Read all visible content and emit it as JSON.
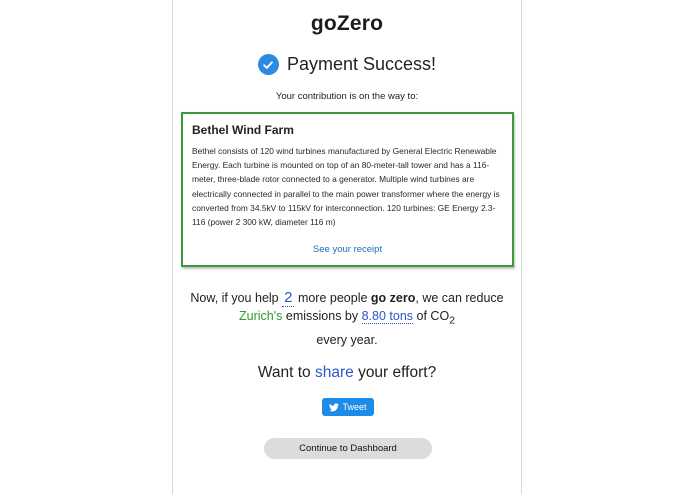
{
  "app": {
    "logo_text": "goZero"
  },
  "header": {
    "success_title": "Payment Success!",
    "contribution_text": "Your contribution is on the way to:"
  },
  "project": {
    "name": "Bethel Wind Farm",
    "description": "Bethel consists of 120 wind turbines manufactured by General Electric Renewable Energy. Each turbine is mounted on top of an 80-meter-tall tower and has a 116-meter, three-blade rotor connected to a generator. Multiple wind turbines are electrically connected in parallel to the main power transformer where the energy is converted from 34.5kV to 115kV for interconnection. 120 turbines: GE Energy 2.3-116 (power 2 300 kW, diameter 116 m)",
    "receipt_link": "See your receipt",
    "border_color": "#3a9a3a"
  },
  "impact": {
    "prefix": "Now, if you help",
    "people_count": "2",
    "middle": "more people",
    "emphasis": "go zero",
    "after_emphasis": ", we can reduce",
    "city": "Zurich's",
    "emissions_text": "emissions by",
    "tons": "8.80 tons",
    "of_text": "of CO",
    "co2_sub": "2",
    "suffix": "every year."
  },
  "share": {
    "prefix": "Want to",
    "word": "share",
    "suffix": "your effort?",
    "tweet_label": "Tweet"
  },
  "footer": {
    "dashboard_label": "Continue to Dashboard"
  },
  "colors": {
    "accent_blue": "#2c57c9",
    "check_blue": "#2d8ae3",
    "green": "#2e9a2e",
    "twitter_blue": "#1d8be8",
    "button_gray": "#dcdcdc"
  },
  "icons": [
    "check-circle-icon",
    "twitter-bird-icon"
  ]
}
